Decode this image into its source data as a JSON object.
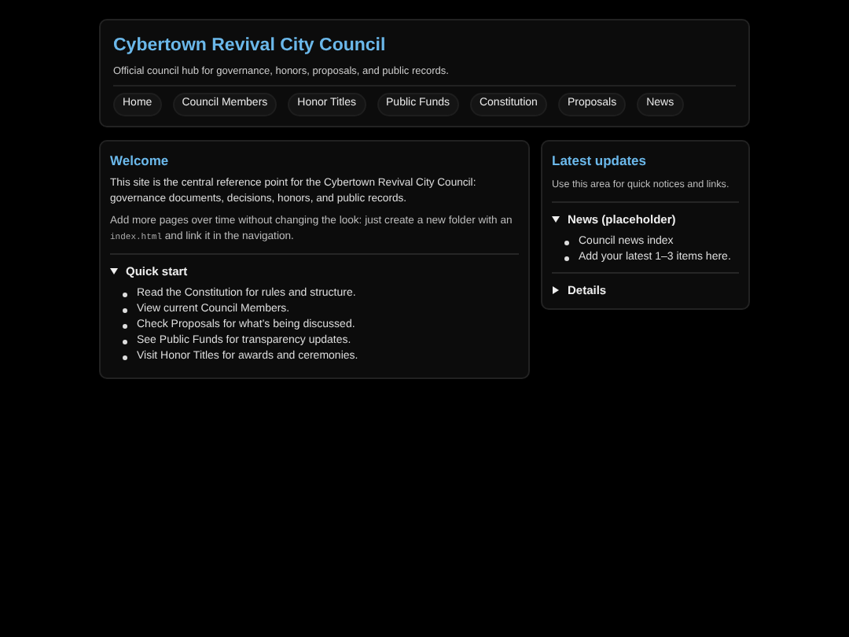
{
  "header": {
    "title": "Cybertown Revival City Council",
    "subtitle": "Official council hub for governance, honors, proposals, and public records.",
    "nav": [
      {
        "label": "Home"
      },
      {
        "label": "Council Members"
      },
      {
        "label": "Honor Titles"
      },
      {
        "label": "Public Funds"
      },
      {
        "label": "Constitution"
      },
      {
        "label": "Proposals"
      },
      {
        "label": "News"
      }
    ]
  },
  "welcome": {
    "title": "Welcome",
    "intro": "This site is the central reference point for the Cybertown Revival City Council: governance documents, decisions, honors, and public records.",
    "note": {
      "before": "Add more pages over time without changing the look: just create a new folder with an",
      "code": "index.html",
      "after": "and link it in the navigation."
    },
    "sections": [
      {
        "label": "Quick start",
        "expanded": true,
        "items": [
          "Read the Constitution for rules and structure.",
          "View current Council Members.",
          "Check Proposals for what’s being discussed.",
          "See Public Funds for transparency updates.",
          "Visit Honor Titles for awards and ceremonies."
        ]
      }
    ]
  },
  "sidebar": {
    "title": "Latest updates",
    "intro": "Use this area for quick notices and links.",
    "sections": [
      {
        "label": "News (placeholder)",
        "expanded": true,
        "items": [
          "Council news index",
          "Add your latest 1–3 items here."
        ]
      },
      {
        "label": "Details",
        "expanded": false
      }
    ]
  }
}
